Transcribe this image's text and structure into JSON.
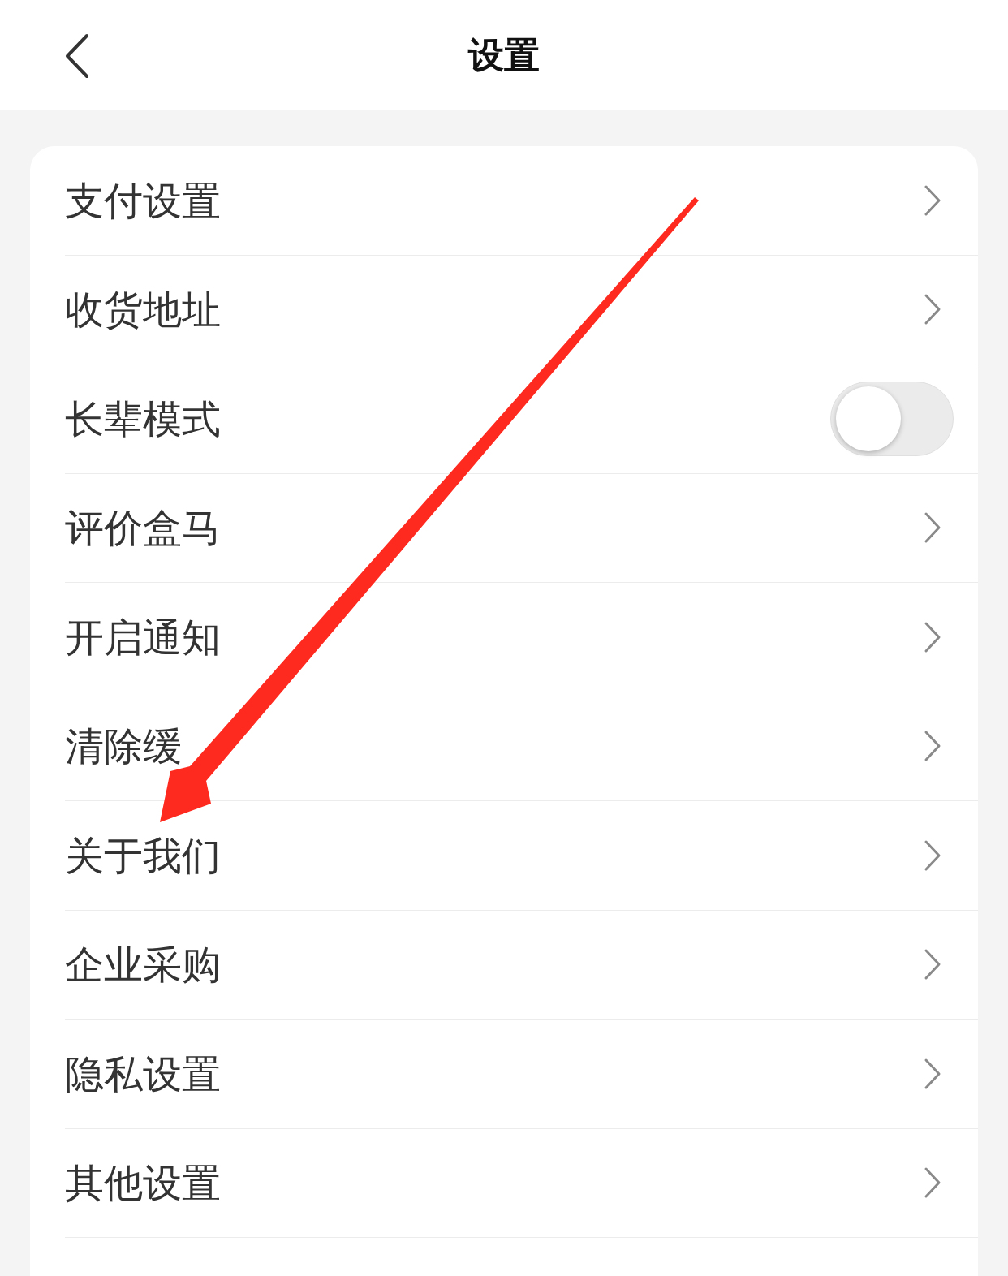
{
  "header": {
    "title": "设置"
  },
  "items": [
    {
      "kind": "link",
      "label": "支付设置"
    },
    {
      "kind": "link",
      "label": "收货地址"
    },
    {
      "kind": "toggle",
      "label": "长辈模式",
      "on": false
    },
    {
      "kind": "link",
      "label": "评价盒马"
    },
    {
      "kind": "link",
      "label": "开启通知"
    },
    {
      "kind": "link",
      "label": "清除缓"
    },
    {
      "kind": "link",
      "label": "关于我们"
    },
    {
      "kind": "link",
      "label": "企业采购"
    },
    {
      "kind": "link",
      "label": "隐私设置"
    },
    {
      "kind": "link",
      "label": "其他设置"
    }
  ]
}
